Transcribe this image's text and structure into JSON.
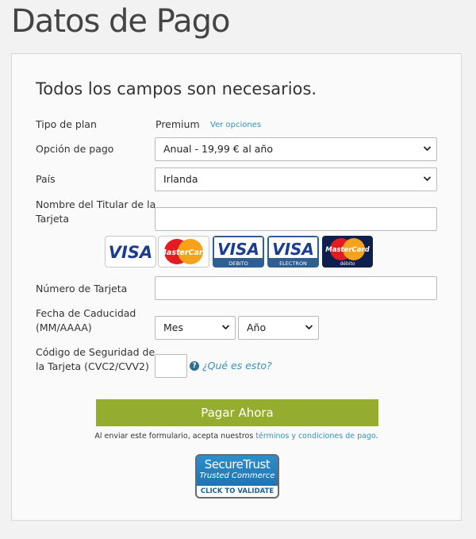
{
  "page": {
    "title": "Datos de Pago"
  },
  "form": {
    "subtitle": "Todos los campos son necesarios.",
    "plan": {
      "label": "Tipo de plan",
      "value": "Premium",
      "link": "Ver opciones"
    },
    "payment_option": {
      "label": "Opción de pago",
      "selected": "Anual - 19,99 € al año"
    },
    "country": {
      "label": "País",
      "selected": "Irlanda"
    },
    "cardholder": {
      "label_line1": "Nombre del Titular de la",
      "label_line2": "Tarjeta",
      "value": ""
    },
    "card_logos": [
      {
        "name": "visa",
        "text": "VISA"
      },
      {
        "name": "mastercard",
        "text": "MasterCard"
      },
      {
        "name": "visa-debito",
        "text": "VISA",
        "sub": "DEBITO"
      },
      {
        "name": "visa-electron",
        "text": "VISA",
        "sub": "ELECTRON"
      },
      {
        "name": "mastercard-debito",
        "text": "MasterCard",
        "sub": "débito"
      }
    ],
    "card_number": {
      "label": "Número de Tarjeta",
      "value": ""
    },
    "expiry": {
      "label_line1": "Fecha de Caducidad",
      "label_line2": "(MM/AAAA)",
      "month": "Mes",
      "year": "Año"
    },
    "cvc": {
      "label_line1": "Código de Seguridad de",
      "label_line2": "la Tarjeta (CVC2/CVV2)",
      "help_icon": "?",
      "help_link": "¿Qué es esto?"
    },
    "submit_label": "Pagar Ahora",
    "terms_prefix": "Al enviar este formulario, acepta nuestros",
    "terms_link": "términos y condiciones de pago",
    "terms_suffix": ".",
    "badge": {
      "line1": "SecureTrust",
      "line2": "Trusted Commerce",
      "line3": "CLICK TO VALIDATE"
    }
  }
}
